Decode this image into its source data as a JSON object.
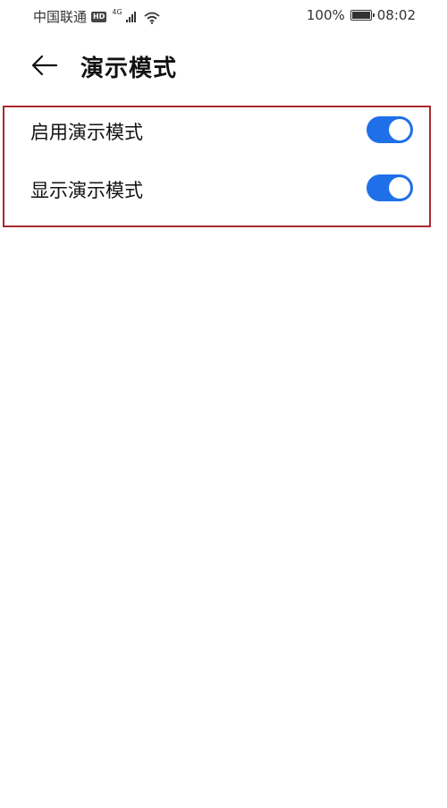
{
  "status_bar": {
    "carrier": "中国联通",
    "hd_label": "HD",
    "network_label": "4G",
    "battery": "100%",
    "time": "08:02"
  },
  "header": {
    "back_icon": "arrow-left-icon",
    "title": "演示模式"
  },
  "settings": {
    "items": [
      {
        "label": "启用演示模式",
        "enabled": true
      },
      {
        "label": "显示演示模式",
        "enabled": true
      }
    ]
  },
  "colors": {
    "toggle_on": "#1f6fe8",
    "highlight_border": "#a92a2d"
  }
}
